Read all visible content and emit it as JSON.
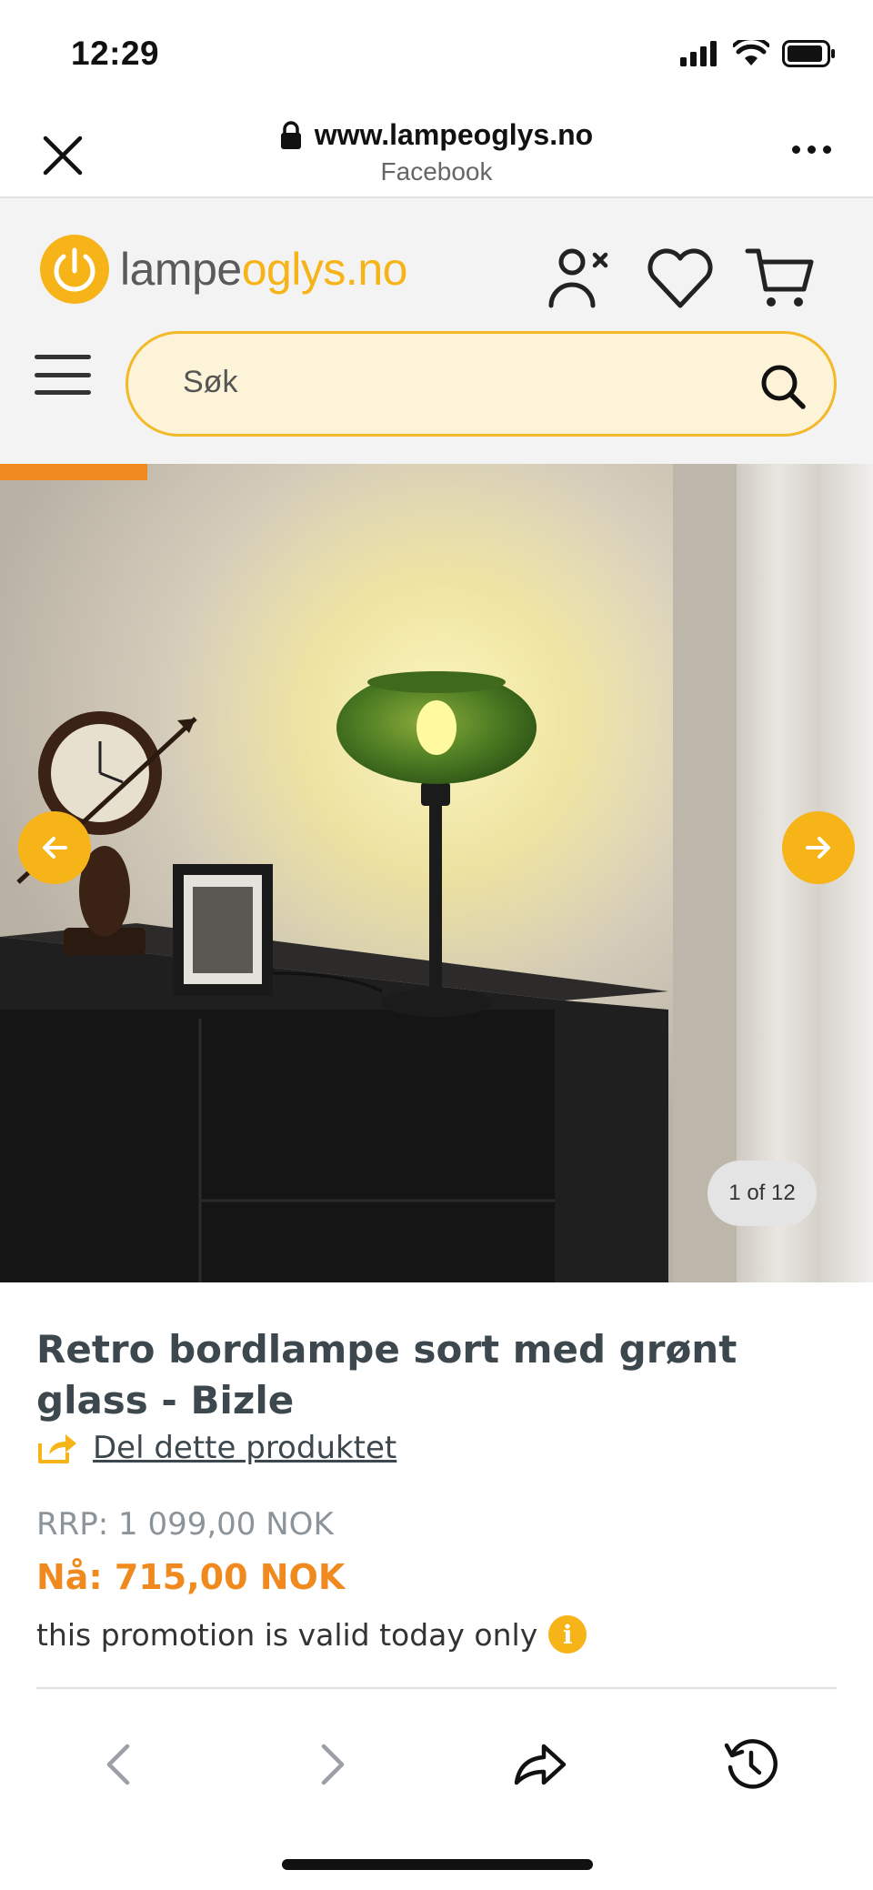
{
  "status_bar": {
    "time": "12:29",
    "icons": [
      "cellular-signal-icon",
      "wifi-icon",
      "battery-icon"
    ]
  },
  "browser": {
    "url": "www.lampeoglys.no",
    "source": "Facebook",
    "icons": [
      "close-icon",
      "lock-icon",
      "more-icon"
    ]
  },
  "site": {
    "logo_part1": "lampe",
    "logo_part2": "oglys",
    "logo_part3": ".no",
    "search": {
      "placeholder": "Søk"
    },
    "icons": [
      "account-icon",
      "heart-icon",
      "cart-icon",
      "menu-icon",
      "search-icon"
    ]
  },
  "gallery": {
    "counter": "1 of 12",
    "icons": [
      "arrow-left-icon",
      "arrow-right-icon"
    ]
  },
  "product": {
    "title": "Retro bordlampe sort med grønt glass - Bizle",
    "share_label": "Del dette produktet",
    "rrp_label": "RRP:",
    "rrp_price": "1 099,00 NOK",
    "now_label": "Nå:",
    "now_price": "715,00 NOK",
    "promo_text": "this promotion is valid today only",
    "info_glyph": "i"
  },
  "toolbar": {
    "icons": [
      "back-icon",
      "forward-icon",
      "share-icon",
      "history-icon"
    ]
  },
  "colors": {
    "brand_yellow": "#f6b418",
    "accent_orange": "#f08a1f",
    "text_dark": "#3c474e",
    "search_bg": "#fdf3d8"
  }
}
